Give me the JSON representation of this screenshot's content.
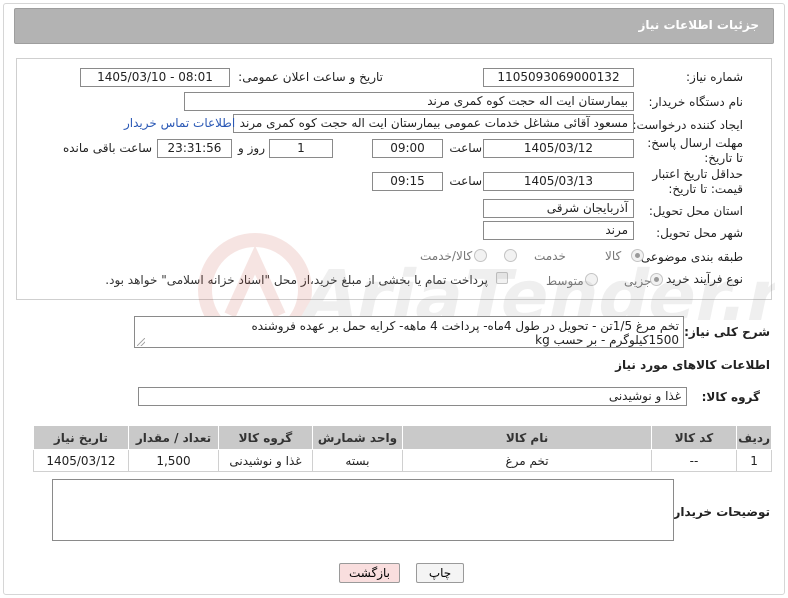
{
  "header": {
    "title": "جزئیات اطلاعات نیاز"
  },
  "form": {
    "need_number_label": "شماره نیاز:",
    "need_number": "1105093069000132",
    "announce_label": "تاریخ و ساعت اعلان عمومی:",
    "announce_value": "1405/03/10 - 08:01",
    "buyer_org_label": "نام دستگاه خریدار:",
    "buyer_org": "بیمارستان ایت اله حجت کوه کمری مرند",
    "creator_label": "ایجاد کننده درخواست:",
    "creator": "مسعود آقائی مشاغل خدمات عمومی بیمارستان ایت اله حجت کوه کمری مرند",
    "contact_link": "اطلاعات تماس خریدار",
    "deadline_label": "مهلت ارسال پاسخ: تا تاریخ:",
    "deadline_date": "1405/03/12",
    "time_label": "ساعت",
    "deadline_time": "09:00",
    "days_value": "1",
    "days_label": "روز و",
    "remaining_time": "23:31:56",
    "remaining_label": "ساعت باقی مانده",
    "price_validity_label": "حداقل تاریخ اعتبار قیمت: تا تاریخ:",
    "price_validity_date": "1405/03/13",
    "price_validity_time": "09:15",
    "province_label": "استان محل تحویل:",
    "province": "آذربایجان شرقی",
    "city_label": "شهر محل تحویل:",
    "city": "مرند",
    "category_label": "طبقه بندی موضوعی:",
    "category_options": [
      "کالا",
      "خدمت",
      "کالا/خدمت"
    ],
    "category_selected": "کالا",
    "process_label": "نوع فرآیند خرید :",
    "process_options": [
      "جزیی",
      "متوسط"
    ],
    "process_selected": "جزیی",
    "payment_note": "پرداخت تمام یا بخشی از مبلغ خرید،از محل \"اسناد خزانه اسلامی\" خواهد بود."
  },
  "description": {
    "label": "شرح کلی نیاز:",
    "text_line1": "تخم مرغ 1/5تن - تحویل در طول  4ماه- پرداخت 4 ماهه- کرایه حمل بر عهده فروشنده",
    "text_line2": "1500کیلوگرم - بر حسب kg"
  },
  "goods_section": {
    "title": "اطلاعات کالاهای مورد نیاز",
    "group_label": "گروه کالا:",
    "group_value": "غذا و نوشیدنی"
  },
  "table": {
    "headers": [
      "ردیف",
      "کد کالا",
      "نام کالا",
      "واحد شمارش",
      "گروه کالا",
      "تعداد / مقدار",
      "تاریخ نیاز"
    ],
    "rows": [
      [
        "1",
        "--",
        "تخم مرغ",
        "بسته",
        "غذا و نوشیدنی",
        "1,500",
        "1405/03/12"
      ]
    ]
  },
  "notes": {
    "label": "توضیحات خریدار:",
    "value": ""
  },
  "buttons": {
    "print": "چاپ",
    "back": "بازگشت"
  },
  "watermark": {
    "text": "AriaTender.net"
  },
  "colors": {
    "header_bg": "#b3b3b3",
    "link": "#2a58b5",
    "back_button_bg": "#f9dede"
  }
}
